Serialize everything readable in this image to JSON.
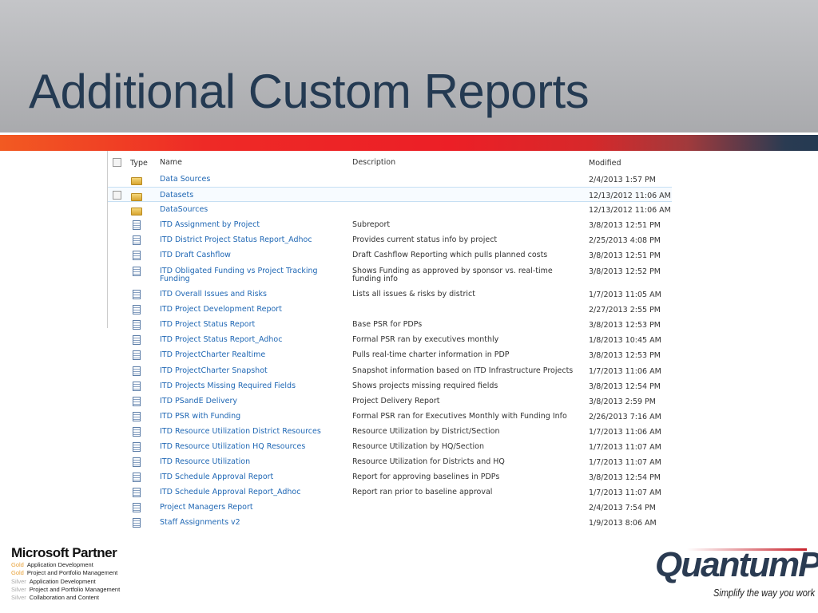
{
  "slide": {
    "title": "Additional Custom Reports"
  },
  "columns": {
    "type": "Type",
    "name": "Name",
    "description": "Description",
    "modified": "Modified"
  },
  "rows": [
    {
      "type": "folder",
      "name": "Data Sources",
      "description": "",
      "modified": "2/4/2013 1:57 PM"
    },
    {
      "type": "folder",
      "name": "Datasets",
      "description": "",
      "modified": "12/13/2012 11:06 AM",
      "selected": true
    },
    {
      "type": "folder",
      "name": "DataSources",
      "description": "",
      "modified": "12/13/2012 11:06 AM"
    },
    {
      "type": "report",
      "name": "ITD Assignment by Project",
      "description": "Subreport",
      "modified": "3/8/2013 12:51 PM"
    },
    {
      "type": "report",
      "name": "ITD District Project Status Report_Adhoc",
      "description": "Provides current status info by project",
      "modified": "2/25/2013 4:08 PM"
    },
    {
      "type": "report",
      "name": "ITD Draft Cashflow",
      "description": "Draft Cashflow Reporting which pulls planned costs",
      "modified": "3/8/2013 12:51 PM"
    },
    {
      "type": "report",
      "name": "ITD Obligated Funding vs Project Tracking Funding",
      "description": "Shows Funding as approved by sponsor vs. real-time funding info",
      "modified": "3/8/2013 12:52 PM",
      "two": true
    },
    {
      "type": "report",
      "name": "ITD Overall Issues and Risks",
      "description": "Lists all issues & risks by district",
      "modified": "1/7/2013 11:05 AM"
    },
    {
      "type": "report",
      "name": "ITD Project Development Report",
      "description": "",
      "modified": "2/27/2013 2:55 PM"
    },
    {
      "type": "report",
      "name": "ITD Project Status Report",
      "description": "Base PSR for PDPs",
      "modified": "3/8/2013 12:53 PM"
    },
    {
      "type": "report",
      "name": "ITD Project Status Report_Adhoc",
      "description": "Formal PSR ran by executives monthly",
      "modified": "1/8/2013 10:45 AM"
    },
    {
      "type": "report",
      "name": "ITD ProjectCharter Realtime",
      "description": "Pulls real-time charter information in PDP",
      "modified": "3/8/2013 12:53 PM"
    },
    {
      "type": "report",
      "name": "ITD ProjectCharter Snapshot",
      "description": "Snapshot information based on ITD Infrastructure Projects",
      "modified": "1/7/2013 11:06 AM"
    },
    {
      "type": "report",
      "name": "ITD Projects Missing Required Fields",
      "description": "Shows projects missing required fields",
      "modified": "3/8/2013 12:54 PM"
    },
    {
      "type": "report",
      "name": "ITD PSandE Delivery",
      "description": "Project Delivery Report",
      "modified": "3/8/2013 2:59 PM"
    },
    {
      "type": "report",
      "name": "ITD PSR with Funding",
      "description": "Formal PSR ran for Executives Monthly with Funding Info",
      "modified": "2/26/2013 7:16 AM"
    },
    {
      "type": "report",
      "name": "ITD Resource Utilization District Resources",
      "description": "Resource Utilization by District/Section",
      "modified": "1/7/2013 11:06 AM"
    },
    {
      "type": "report",
      "name": "ITD Resource Utilization HQ Resources",
      "description": "Resource Utilization by HQ/Section",
      "modified": "1/7/2013 11:07 AM"
    },
    {
      "type": "report",
      "name": "ITD Resource Utilization",
      "description": "Resource Utilization for Districts and HQ",
      "modified": "1/7/2013 11:07 AM"
    },
    {
      "type": "report",
      "name": "ITD Schedule Approval Report",
      "description": "Report for approving baselines in PDPs",
      "modified": "3/8/2013 12:54 PM"
    },
    {
      "type": "report",
      "name": "ITD Schedule Approval Report_Adhoc",
      "description": "Report ran prior to baseline approval",
      "modified": "1/7/2013 11:07 AM"
    },
    {
      "type": "report",
      "name": "Project Managers Report",
      "description": "",
      "modified": "2/4/2013 7:54 PM"
    },
    {
      "type": "report",
      "name": "Staff Assignments v2",
      "description": "",
      "modified": "1/9/2013 8:06 AM"
    }
  ],
  "partner": {
    "title": "Microsoft Partner",
    "items": [
      {
        "level": "Gold",
        "area": "Application Development"
      },
      {
        "level": "Gold",
        "area": "Project and Portfolio Management"
      },
      {
        "level": "Silver",
        "area": "Application Development"
      },
      {
        "level": "Silver",
        "area": "Project and Portfolio Management"
      },
      {
        "level": "Silver",
        "area": "Collaboration and Content"
      }
    ]
  },
  "brand": {
    "logo": "QuantumPM",
    "tagline": "Simplify the way you work"
  }
}
